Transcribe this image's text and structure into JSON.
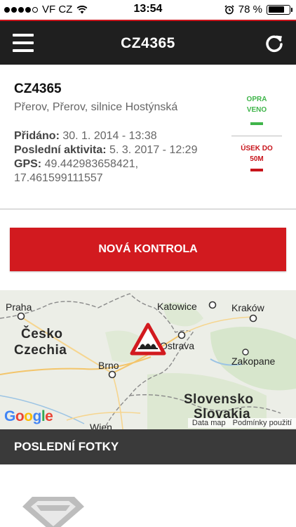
{
  "status_bar": {
    "carrier": "VF CZ",
    "time": "13:54",
    "battery_percent_label": "78 %",
    "battery_level": 0.78
  },
  "nav": {
    "title": "CZ4365"
  },
  "info": {
    "title": "CZ4365",
    "address": "Přerov, Přerov, silnice Hostýnská",
    "added_label": "Přidáno:",
    "added_value": "30. 1. 2014 - 13:38",
    "activity_label": "Poslední aktivita:",
    "activity_value": "5. 3. 2017 - 12:29",
    "gps_label": "GPS:",
    "gps_value": "49.442983658421, 17.461599111557"
  },
  "status": {
    "fixed_line1": "OPRA",
    "fixed_line2": "VENO",
    "section_line1": "ÚSEK DO",
    "section_line2": "50M"
  },
  "colors": {
    "accent": "#d21a1f",
    "fixed": "#3fb54a",
    "navbar": "#1f1f1f",
    "section": "#3a3a3a"
  },
  "actions": {
    "new_check_label": "NOVÁ KONTROLA"
  },
  "map": {
    "cities": {
      "praha": "Praha",
      "katowice": "Katowice",
      "krakow": "Kraków",
      "ostrava": "Ostrava",
      "brno": "Brno",
      "zakopane": "Zakopane",
      "wien": "Wien"
    },
    "countries": {
      "cz_local": "Česko",
      "cz_en": "Czechia",
      "sk_local": "Slovensko",
      "sk_en": "Slovakia"
    },
    "logo": "Google",
    "data_label": "Data map",
    "terms_label": "Podmínky použití",
    "marker_icon": "warning-triangle-bumpy-road-icon"
  },
  "photos": {
    "header": "POSLEDNÍ FOTKY"
  }
}
